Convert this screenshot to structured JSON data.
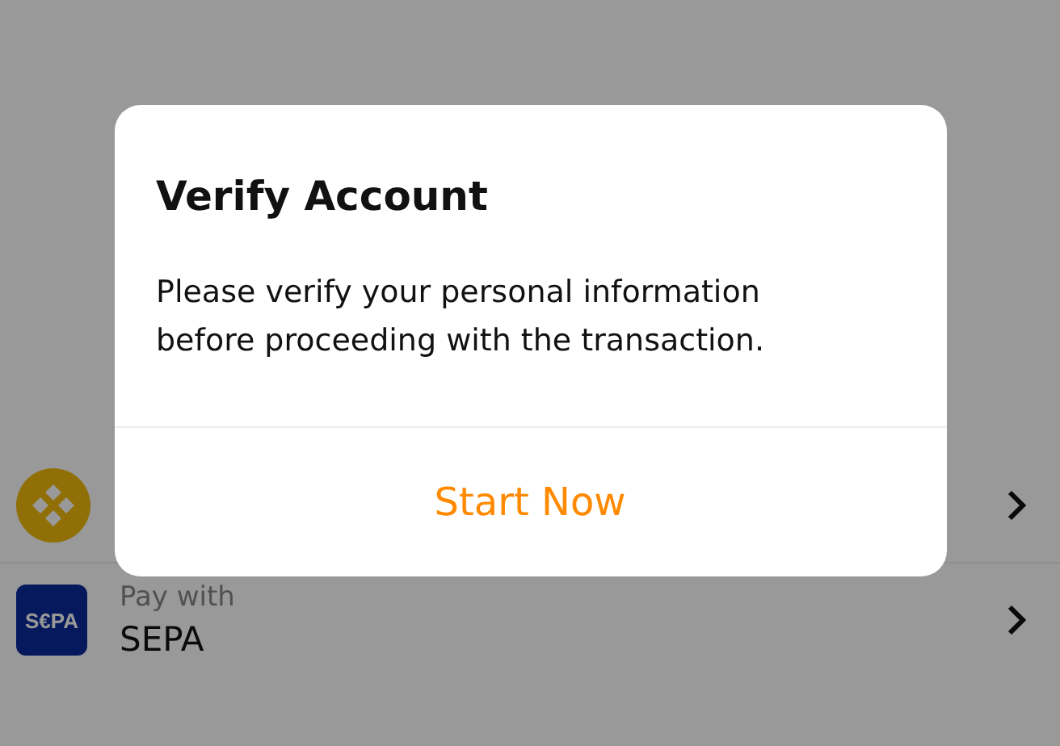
{
  "payment_methods": [
    {
      "kind": "crypto"
    },
    {
      "kind": "sepa",
      "logo_text": "S€PA",
      "caption": "Pay with",
      "name": "SEPA"
    }
  ],
  "dialog": {
    "title": "Verify Account",
    "message": "Please verify your personal information before proceeding with the transaction.",
    "action": "Start Now"
  }
}
